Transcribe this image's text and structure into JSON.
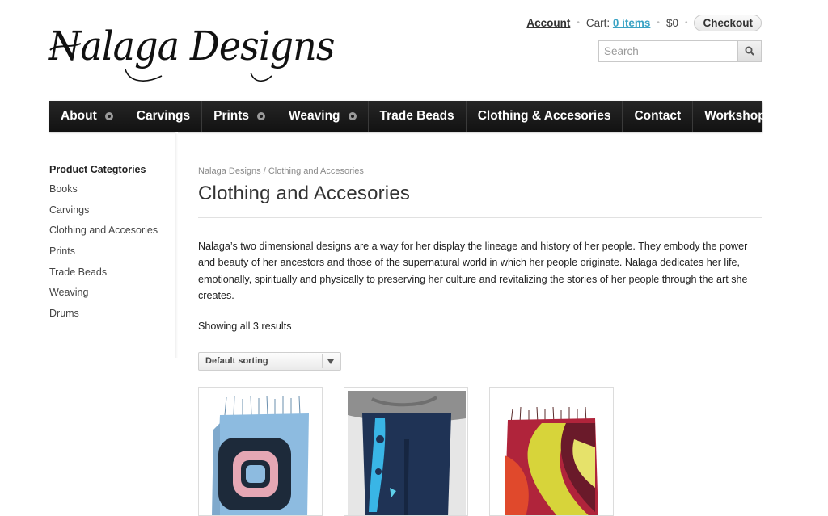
{
  "site": {
    "logo_text": "Nalaga Designs"
  },
  "topbar": {
    "account_label": "Account",
    "cart_prefix": "Cart:",
    "cart_items": "0 items",
    "cart_total": "$0",
    "checkout_label": "Checkout"
  },
  "search": {
    "placeholder": "Search",
    "button_icon": "search-icon"
  },
  "nav": {
    "items": [
      {
        "label": "About",
        "has_submenu": true
      },
      {
        "label": "Carvings",
        "has_submenu": false
      },
      {
        "label": "Prints",
        "has_submenu": true
      },
      {
        "label": "Weaving",
        "has_submenu": true
      },
      {
        "label": "Trade Beads",
        "has_submenu": false
      },
      {
        "label": "Clothing & Accesories",
        "has_submenu": false
      },
      {
        "label": "Contact",
        "has_submenu": false
      },
      {
        "label": "Workshops",
        "has_submenu": false
      }
    ]
  },
  "sidebar": {
    "title": "Product Categtories",
    "items": [
      "Books",
      "Carvings",
      "Clothing and Accesories",
      "Prints",
      "Trade Beads",
      "Weaving",
      "Drums"
    ]
  },
  "main": {
    "breadcrumb": "Nalaga Designs / Clothing and Accesories",
    "title": "Clothing and Accesories",
    "description": "Nalaga’s two dimensional designs are a way for her display the lineage and history of her people. They embody the power and beauty of her ancestors and those of the supernatural world in which her people originate. Nalaga dedicates her life, emotionally, spiritually and physically to preserving her culture and revitalizing the stories of her people through the art she creates.",
    "result_count": "Showing all 3 results",
    "sort": {
      "selected": "Default sorting"
    }
  },
  "products": [
    {
      "image": "blue-scarf-with-pink-formline-design"
    },
    {
      "image": "navy-sweatpants-with-blue-formline-design"
    },
    {
      "image": "red-yellow-green-scarf"
    }
  ],
  "colors": {
    "nav_bg": "#1b1b1b",
    "link_accent": "#3aa3c4",
    "text": "#222222"
  }
}
